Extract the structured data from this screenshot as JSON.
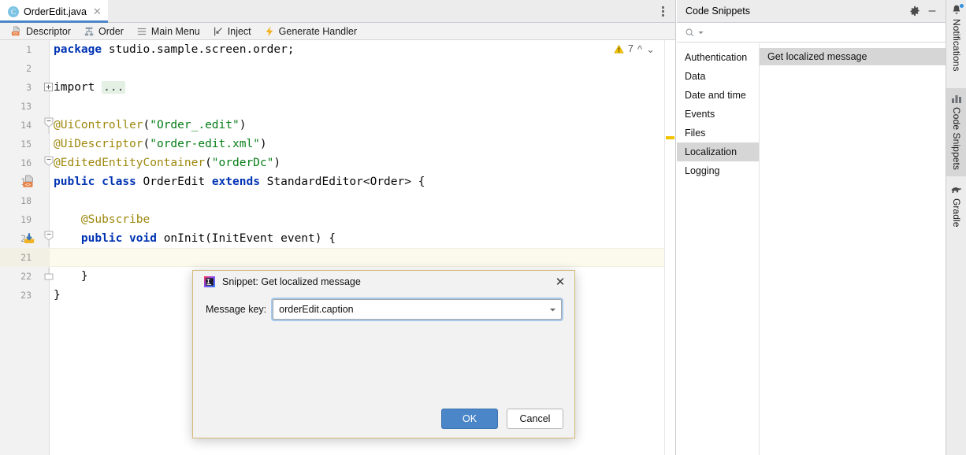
{
  "editor": {
    "tab": {
      "filename": "OrderEdit.java",
      "file_icon": "java-class-icon",
      "close_icon": "close-icon",
      "kebab_icon": "more-options-icon"
    },
    "navbar": [
      {
        "label": "Descriptor",
        "icon": "descriptor-xml-icon"
      },
      {
        "label": "Order",
        "icon": "entity-hierarchy-icon"
      },
      {
        "label": "Main Menu",
        "icon": "hamburger-menu-icon"
      },
      {
        "label": "Inject",
        "icon": "inject-arrow-icon"
      },
      {
        "label": "Generate Handler",
        "icon": "lightning-bolt-icon"
      }
    ],
    "inspection": {
      "warning_icon": "warning-triangle-icon",
      "warning_count": "7",
      "prev_icon": "chevron-up-icon",
      "next_icon": "chevron-down-icon"
    },
    "lines": [
      {
        "num": "1",
        "tokens": [
          {
            "t": "kw",
            "v": "package"
          },
          {
            "t": "plain",
            "v": " studio.sample.screen.order;"
          }
        ]
      },
      {
        "num": "2",
        "tokens": []
      },
      {
        "num": "3",
        "tokens": [
          {
            "t": "plain",
            "v": "import "
          },
          {
            "t": "folded",
            "v": "..."
          }
        ],
        "fold": "expand"
      },
      {
        "num": "13",
        "tokens": []
      },
      {
        "num": "14",
        "tokens": [
          {
            "t": "ann",
            "v": "@UiController"
          },
          {
            "t": "plain",
            "v": "("
          },
          {
            "t": "str",
            "v": "\"Order_.edit\""
          },
          {
            "t": "plain",
            "v": ")"
          }
        ],
        "fold": "collapse-top"
      },
      {
        "num": "15",
        "tokens": [
          {
            "t": "ann",
            "v": "@UiDescriptor"
          },
          {
            "t": "plain",
            "v": "("
          },
          {
            "t": "str",
            "v": "\"order-edit.xml\""
          },
          {
            "t": "plain",
            "v": ")"
          }
        ]
      },
      {
        "num": "16",
        "tokens": [
          {
            "t": "ann",
            "v": "@EditedEntityContainer"
          },
          {
            "t": "plain",
            "v": "("
          },
          {
            "t": "str",
            "v": "\"orderDc\""
          },
          {
            "t": "plain",
            "v": ")"
          }
        ],
        "fold": "collapse-mid"
      },
      {
        "num": "17",
        "tokens": [
          {
            "t": "kw",
            "v": "public"
          },
          {
            "t": "plain",
            "v": " "
          },
          {
            "t": "kw",
            "v": "class"
          },
          {
            "t": "plain",
            "v": " OrderEdit "
          },
          {
            "t": "kw",
            "v": "extends"
          },
          {
            "t": "plain",
            "v": " StandardEditor<Order> {"
          }
        ],
        "gicon": "descriptor-gutter-icon"
      },
      {
        "num": "18",
        "tokens": []
      },
      {
        "num": "19",
        "tokens": [
          {
            "t": "ann",
            "v": "    @Subscribe"
          }
        ]
      },
      {
        "num": "20",
        "tokens": [
          {
            "t": "plain",
            "v": "    "
          },
          {
            "t": "kw",
            "v": "public"
          },
          {
            "t": "plain",
            "v": " "
          },
          {
            "t": "kw",
            "v": "void"
          },
          {
            "t": "plain",
            "v": " onInit(InitEvent event) {"
          }
        ],
        "gicon": "event-subscribe-gutter-icon",
        "fold": "collapse-top"
      },
      {
        "num": "21",
        "tokens": [],
        "current": true
      },
      {
        "num": "22",
        "tokens": [
          {
            "t": "plain",
            "v": "    }"
          }
        ],
        "fold": "collapse-bottom"
      },
      {
        "num": "23",
        "tokens": [
          {
            "t": "plain",
            "v": "}"
          }
        ]
      }
    ],
    "marker_icon": "warning-marker"
  },
  "snippets_panel": {
    "title": "Code Snippets",
    "settings_icon": "gear-icon",
    "minimize_icon": "minimize-icon",
    "search": {
      "icon": "search-icon",
      "placeholder": "",
      "value": ""
    },
    "categories": [
      "Authentication",
      "Data",
      "Date and time",
      "Events",
      "Files",
      "Localization",
      "Logging"
    ],
    "selected_category": "Localization",
    "snippets": [
      "Get localized message"
    ],
    "selected_snippet": "Get localized message"
  },
  "right_rail": [
    {
      "label": "Notifications",
      "icon": "bell-icon",
      "active": false,
      "badge": true
    },
    {
      "label": "Code Snippets",
      "icon": "snippets-icon",
      "active": true,
      "badge": false
    },
    {
      "label": "Gradle",
      "icon": "gradle-elephant-icon",
      "active": false,
      "badge": false
    }
  ],
  "dialog": {
    "app_icon": "intellij-idea-icon",
    "title": "Snippet: Get localized message",
    "close_icon": "close-icon",
    "field_label": "Message key:",
    "field_value": "orderEdit.caption",
    "field_placeholder": "",
    "dropdown_icon": "chevron-down-icon",
    "ok_label": "OK",
    "cancel_label": "Cancel"
  },
  "colors": {
    "accent_blue": "#4a86c8",
    "tab_underline": "#4a86c8",
    "selection_grey": "#d6d6d6",
    "keyword": "#0033b3",
    "string": "#067d17",
    "annotation": "#9e880d",
    "warning_yellow": "#f2c300",
    "dialog_border": "#d6b879",
    "current_line": "#fcfaed"
  }
}
